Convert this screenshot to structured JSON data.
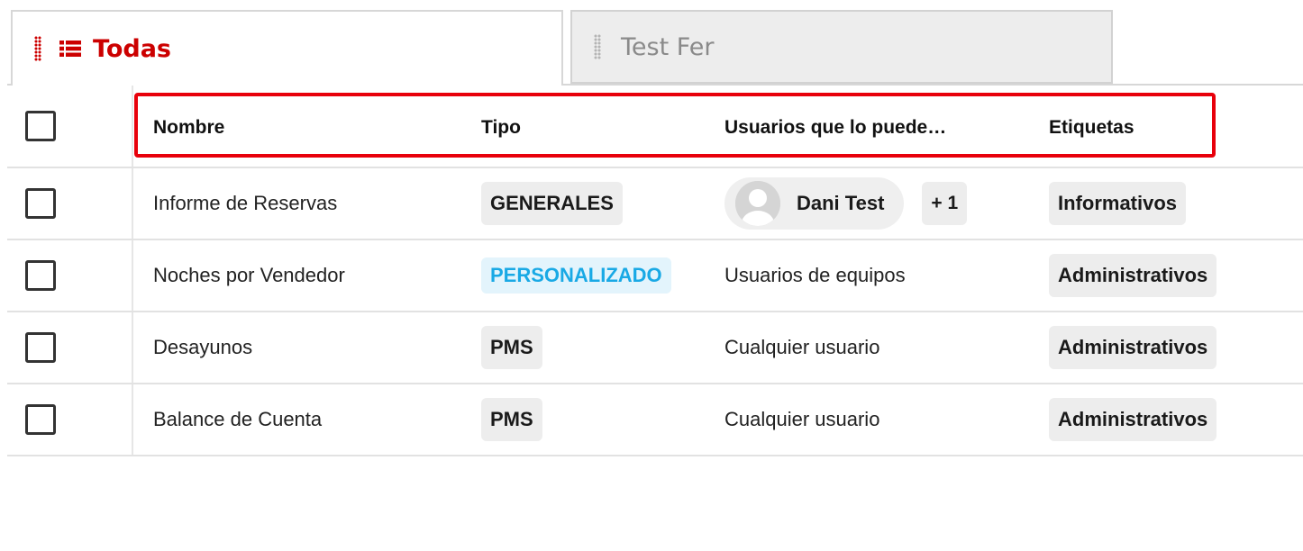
{
  "tabs": [
    {
      "label": "Todas",
      "active": true,
      "icon": "list-icon"
    },
    {
      "label": "Test Fer",
      "active": false
    }
  ],
  "table": {
    "columns": {
      "name": "Nombre",
      "type": "Tipo",
      "users": "Usuarios que lo puede…",
      "tags": "Etiquetas"
    },
    "rows": [
      {
        "name": "Informe de Reservas",
        "type": "GENERALES",
        "users": {
          "chip": "Dani Test",
          "more": "+ 1"
        },
        "tag": "Informativos"
      },
      {
        "name": "Noches por Vendedor",
        "type": "PERSONALIZADO",
        "users": "Usuarios de equipos",
        "tag": "Administrativos"
      },
      {
        "name": "Desayunos",
        "type": "PMS",
        "users": "Cualquier usuario",
        "tag": "Administrativos"
      },
      {
        "name": "Balance de Cuenta",
        "type": "PMS",
        "users": "Cualquier usuario",
        "tag": "Administrativos"
      }
    ]
  },
  "colors": {
    "accent": "#cc0000",
    "highlight_border": "#e8000b",
    "custom_badge_text": "#19a9e5",
    "custom_badge_bg": "#e3f4fc",
    "badge_bg": "#ededed"
  }
}
